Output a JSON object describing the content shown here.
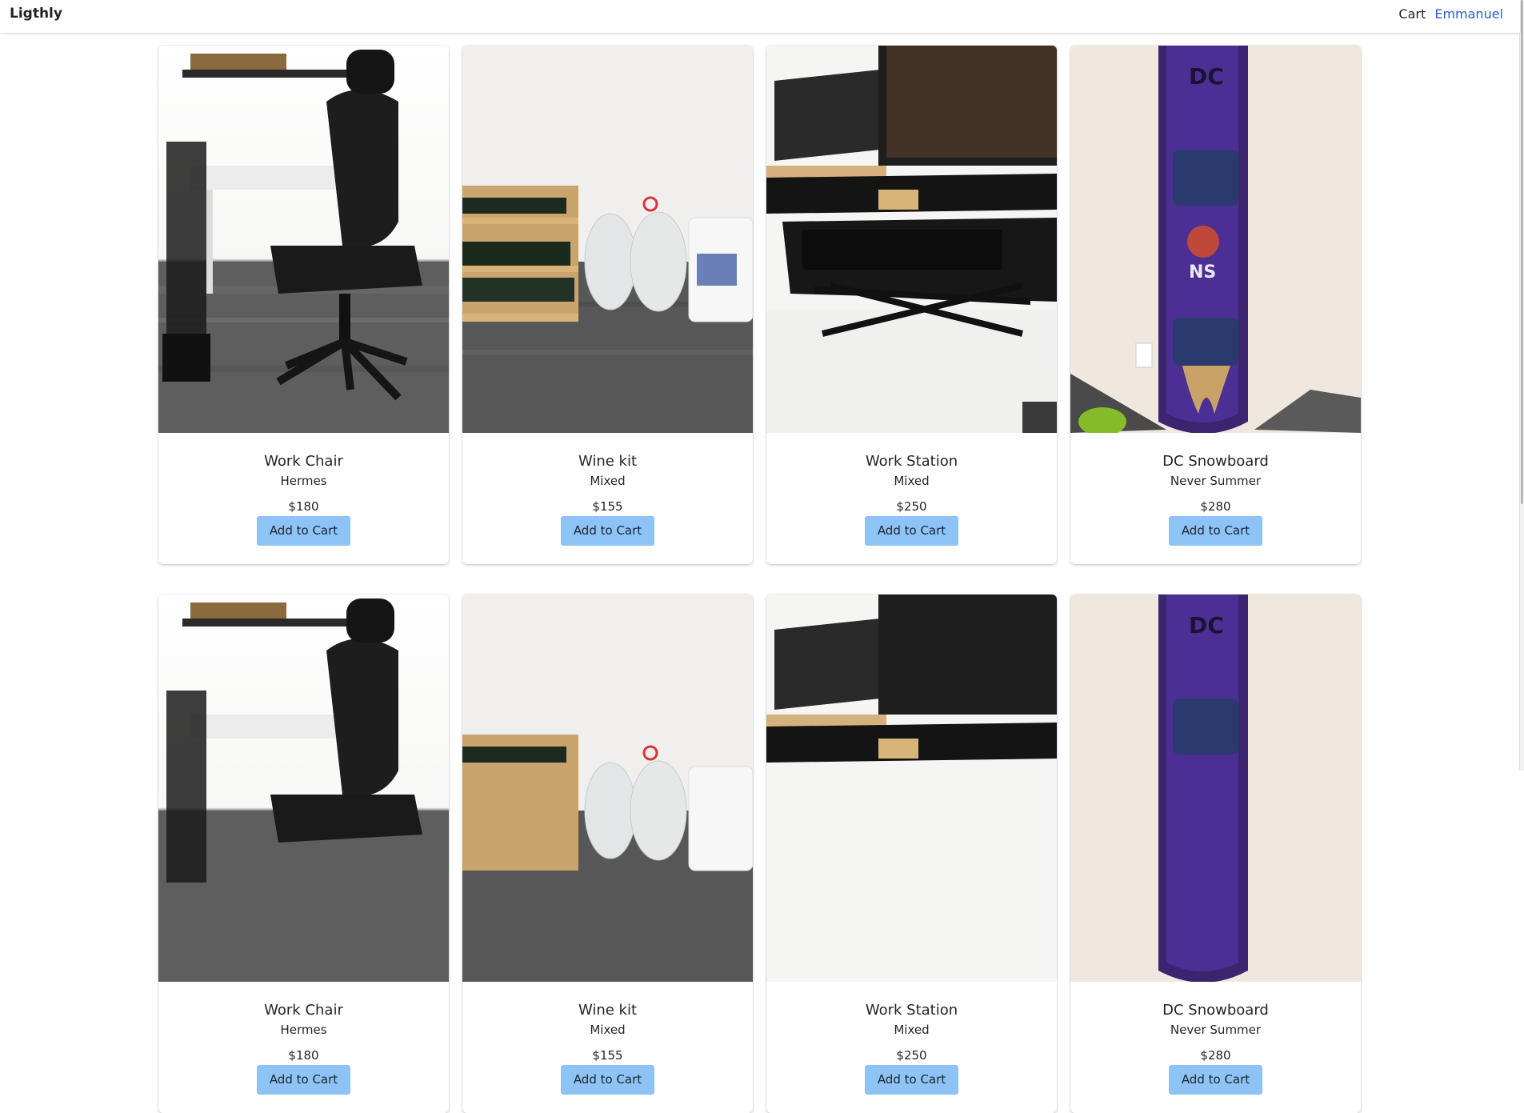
{
  "app": {
    "brand": "Ligthly",
    "nav": {
      "cart_label": "Cart",
      "user_label": "Emmanuel"
    }
  },
  "colors": {
    "button_bg": "#8ec3f7",
    "user_link": "#2d5bcf"
  },
  "products": [
    {
      "title": "Work Chair",
      "subtitle": "Hermes",
      "price": "$180",
      "button": "Add to Cart",
      "image": "office-chair"
    },
    {
      "title": "Wine kit",
      "subtitle": "Mixed",
      "price": "$155",
      "button": "Add to Cart",
      "image": "wine-bottles-jugs"
    },
    {
      "title": "Work Station",
      "subtitle": "Mixed",
      "price": "$250",
      "button": "Add to Cart",
      "image": "standing-desk"
    },
    {
      "title": "DC Snowboard",
      "subtitle": "Never Summer",
      "price": "$280",
      "button": "Add to Cart",
      "image": "snowboard"
    },
    {
      "title": "Work Chair",
      "subtitle": "Hermes",
      "price": "$180",
      "button": "Add to Cart",
      "image": "office-chair"
    },
    {
      "title": "Wine kit",
      "subtitle": "Mixed",
      "price": "$155",
      "button": "Add to Cart",
      "image": "wine-bottles-jugs"
    },
    {
      "title": "Work Station",
      "subtitle": "Mixed",
      "price": "$250",
      "button": "Add to Cart",
      "image": "standing-desk"
    },
    {
      "title": "DC Snowboard",
      "subtitle": "Never Summer",
      "price": "$280",
      "button": "Add to Cart",
      "image": "snowboard"
    }
  ]
}
